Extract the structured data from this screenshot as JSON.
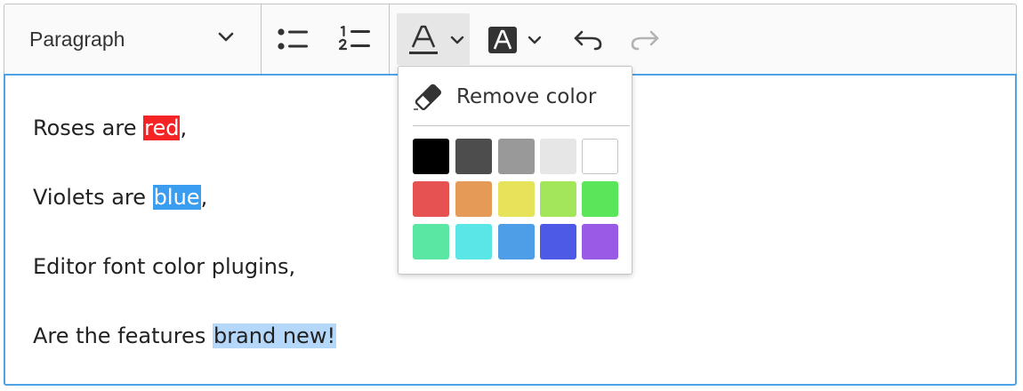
{
  "toolbar": {
    "heading_select": {
      "value": "Paragraph"
    },
    "buttons": {
      "bulleted_list": "bulleted-list",
      "numbered_list": "numbered-list",
      "font_color": "font-color",
      "font_background_color": "font-background-color",
      "undo": "undo",
      "redo": "redo"
    },
    "icons": {
      "chevron": "chevron-down-icon",
      "bulleted_list": "bulleted-list-icon",
      "numbered_list": "numbered-list-icon",
      "font_color": "font-color-icon",
      "font_background": "font-background-icon",
      "undo": "undo-icon",
      "redo": "redo-icon",
      "eraser": "eraser-icon"
    },
    "font_color_active": true,
    "redo_disabled": true
  },
  "editor": {
    "paragraphs": [
      {
        "segments": [
          {
            "text": "Roses are "
          },
          {
            "text": "red",
            "color": "#ffffff",
            "background": "#f42424"
          },
          {
            "text": ","
          }
        ]
      },
      {
        "segments": [
          {
            "text": "Violets are "
          },
          {
            "text": "blue",
            "color": "#ffffff",
            "background": "#3b9df0"
          },
          {
            "text": ","
          }
        ]
      },
      {
        "segments": [
          {
            "text": "Editor font color plugins,"
          }
        ]
      },
      {
        "segments": [
          {
            "text": "Are the features "
          },
          {
            "text": "brand new!",
            "background": "#b4d7fa"
          }
        ]
      }
    ]
  },
  "color_dropdown": {
    "remove_color_label": "Remove color",
    "swatches": [
      "#000000",
      "#4d4d4d",
      "#999999",
      "#e6e6e6",
      "#ffffff",
      "#e65151",
      "#e69a58",
      "#e6e35a",
      "#a3e65a",
      "#5ae65a",
      "#5ae6a3",
      "#5ae6e6",
      "#4d9ee6",
      "#4d5ae6",
      "#9a5ae6"
    ]
  },
  "colors": {
    "focus_border": "#4ea3e6",
    "toolbar_bg": "#fafafa",
    "active_button_bg": "#e6e6e6",
    "border": "#c4c4c4"
  }
}
